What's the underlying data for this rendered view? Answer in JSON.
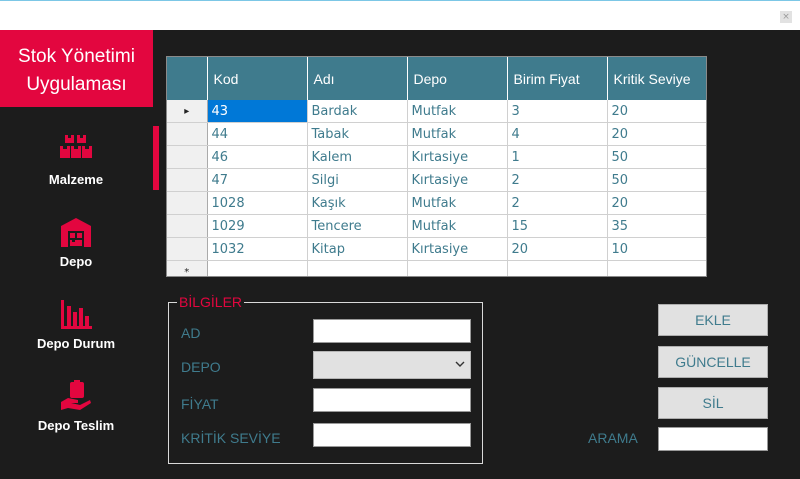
{
  "window": {
    "close_glyph": "×"
  },
  "sidebar": {
    "brand_line1": "Stok Yönetimi",
    "brand_line2": "Uygulaması",
    "brand_color": "#e3063f",
    "items": [
      {
        "label": "Malzeme",
        "icon": "boxes-icon",
        "active": true
      },
      {
        "label": "Depo",
        "icon": "warehouse-icon"
      },
      {
        "label": "Depo Durum",
        "icon": "bar-chart-icon"
      },
      {
        "label": "Depo Teslim",
        "icon": "hand-package-icon"
      }
    ]
  },
  "grid": {
    "columns": [
      "Kod",
      "Adı",
      "Depo",
      "Birim Fiyat",
      "Kritik Seviye"
    ],
    "rows": [
      [
        "43",
        "Bardak",
        "Mutfak",
        "3",
        "20"
      ],
      [
        "44",
        "Tabak",
        "Mutfak",
        "4",
        "20"
      ],
      [
        "46",
        "Kalem",
        "Kırtasiye",
        "1",
        "50"
      ],
      [
        "47",
        "Silgi",
        "Kırtasiye",
        "2",
        "50"
      ],
      [
        "1028",
        "Kaşık",
        "Mutfak",
        "2",
        "20"
      ],
      [
        "1029",
        "Tencere",
        "Mutfak",
        "15",
        "35"
      ],
      [
        "1032",
        "Kitap",
        "Kırtasiye",
        "20",
        "10"
      ]
    ],
    "current_row_glyph": "▸",
    "new_row_glyph": "*",
    "header_color": "#3f7b8d"
  },
  "info": {
    "legend": "BİLGİLER",
    "ad_label": "AD",
    "ad_value": "",
    "depo_label": "DEPO",
    "depo_value": "",
    "fiyat_label": "FİYAT",
    "fiyat_value": "",
    "kritik_label": "KRİTİK SEVİYE",
    "kritik_value": ""
  },
  "actions": {
    "add_label": "EKLE",
    "update_label": "GÜNCELLE",
    "delete_label": "SİL",
    "search_label": "ARAMA",
    "search_value": ""
  }
}
